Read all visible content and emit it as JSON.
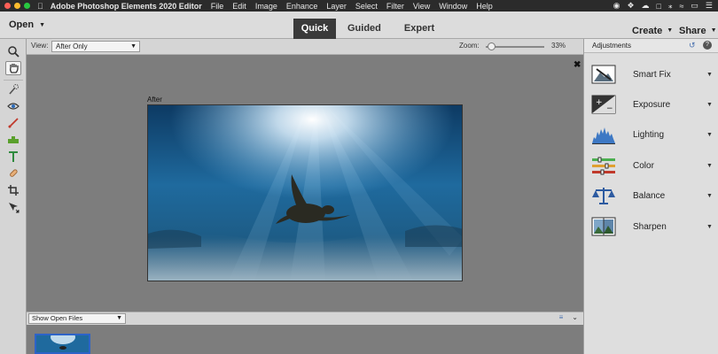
{
  "menubar": {
    "app_name": "Adobe Photoshop Elements 2020 Editor",
    "items": [
      "File",
      "Edit",
      "Image",
      "Enhance",
      "Layer",
      "Select",
      "Filter",
      "View",
      "Window",
      "Help"
    ]
  },
  "appbar": {
    "open_label": "Open",
    "modes": [
      "Quick",
      "Guided",
      "Expert"
    ],
    "active_mode": "Quick",
    "create_label": "Create",
    "share_label": "Share"
  },
  "options": {
    "view_label": "View:",
    "view_value": "After Only",
    "zoom_label": "Zoom:",
    "zoom_value": "33%",
    "zoom_level": 0.05
  },
  "canvas": {
    "after_label": "After"
  },
  "bin": {
    "select_value": "Show Open Files"
  },
  "panel": {
    "title": "Adjustments",
    "adjustments": [
      {
        "label": "Smart Fix",
        "icon": "smart-fix-icon"
      },
      {
        "label": "Exposure",
        "icon": "exposure-icon"
      },
      {
        "label": "Lighting",
        "icon": "lighting-icon"
      },
      {
        "label": "Color",
        "icon": "color-icon"
      },
      {
        "label": "Balance",
        "icon": "balance-icon"
      },
      {
        "label": "Sharpen",
        "icon": "sharpen-icon"
      }
    ]
  },
  "colors": {
    "active_mode_bg": "#3a3a3a",
    "accent_blue": "#2d63c8",
    "traffic_red": "#fe5f57",
    "traffic_yellow": "#febc2e",
    "traffic_green": "#28c840"
  }
}
